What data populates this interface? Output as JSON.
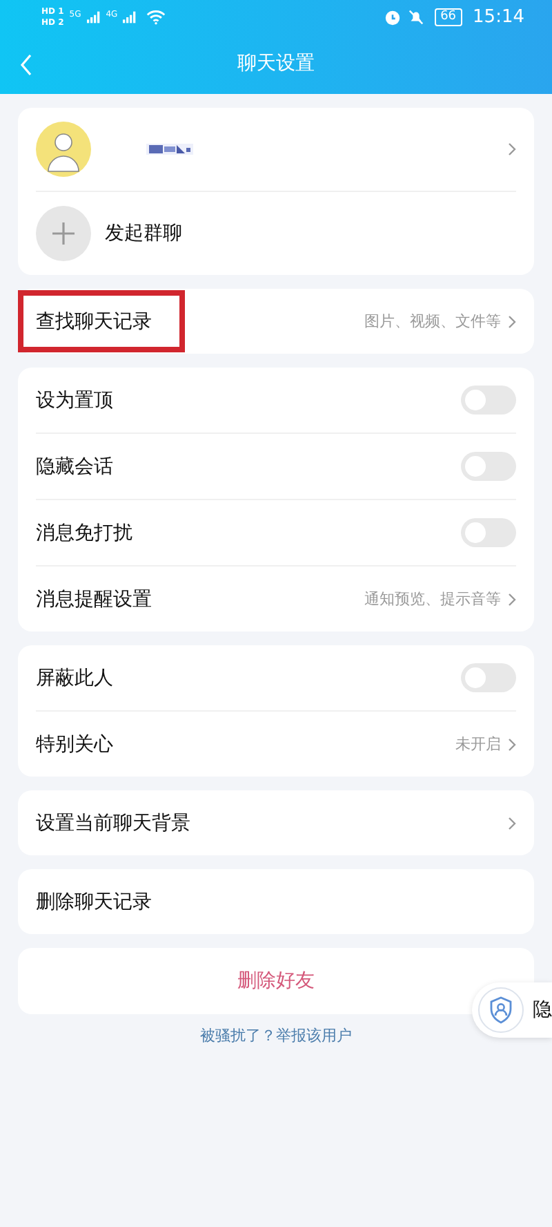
{
  "status_bar": {
    "sim_1": "HD 1",
    "sim_2": "HD 2",
    "network_1": "5G",
    "network_2": "4G",
    "battery": "66",
    "time": "15:14"
  },
  "header": {
    "title": "聊天设置"
  },
  "profile": {
    "new_group_label": "发起群聊"
  },
  "groups": [
    {
      "items": [
        {
          "kind": "link",
          "label": "查找聊天记录",
          "value": "图片、视频、文件等",
          "highlighted": true
        }
      ]
    },
    {
      "items": [
        {
          "kind": "toggle",
          "label": "设为置顶",
          "on": false
        },
        {
          "kind": "toggle",
          "label": "隐藏会话",
          "on": false
        },
        {
          "kind": "toggle",
          "label": "消息免打扰",
          "on": false
        },
        {
          "kind": "link",
          "label": "消息提醒设置",
          "value": "通知预览、提示音等",
          "highlighted": false
        }
      ]
    },
    {
      "items": [
        {
          "kind": "toggle",
          "label": "屏蔽此人",
          "on": false
        },
        {
          "kind": "link",
          "label": "特别关心",
          "value": "未开启",
          "highlighted": false
        }
      ]
    },
    {
      "items": [
        {
          "kind": "link",
          "label": "设置当前聊天背景",
          "highlighted": false
        }
      ]
    },
    {
      "items": [
        {
          "kind": "action",
          "label": "删除聊天记录"
        }
      ]
    }
  ],
  "delete_button": "删除好友",
  "report_link": "被骚扰了？举报该用户",
  "floating_pill": {
    "label": "隐"
  }
}
